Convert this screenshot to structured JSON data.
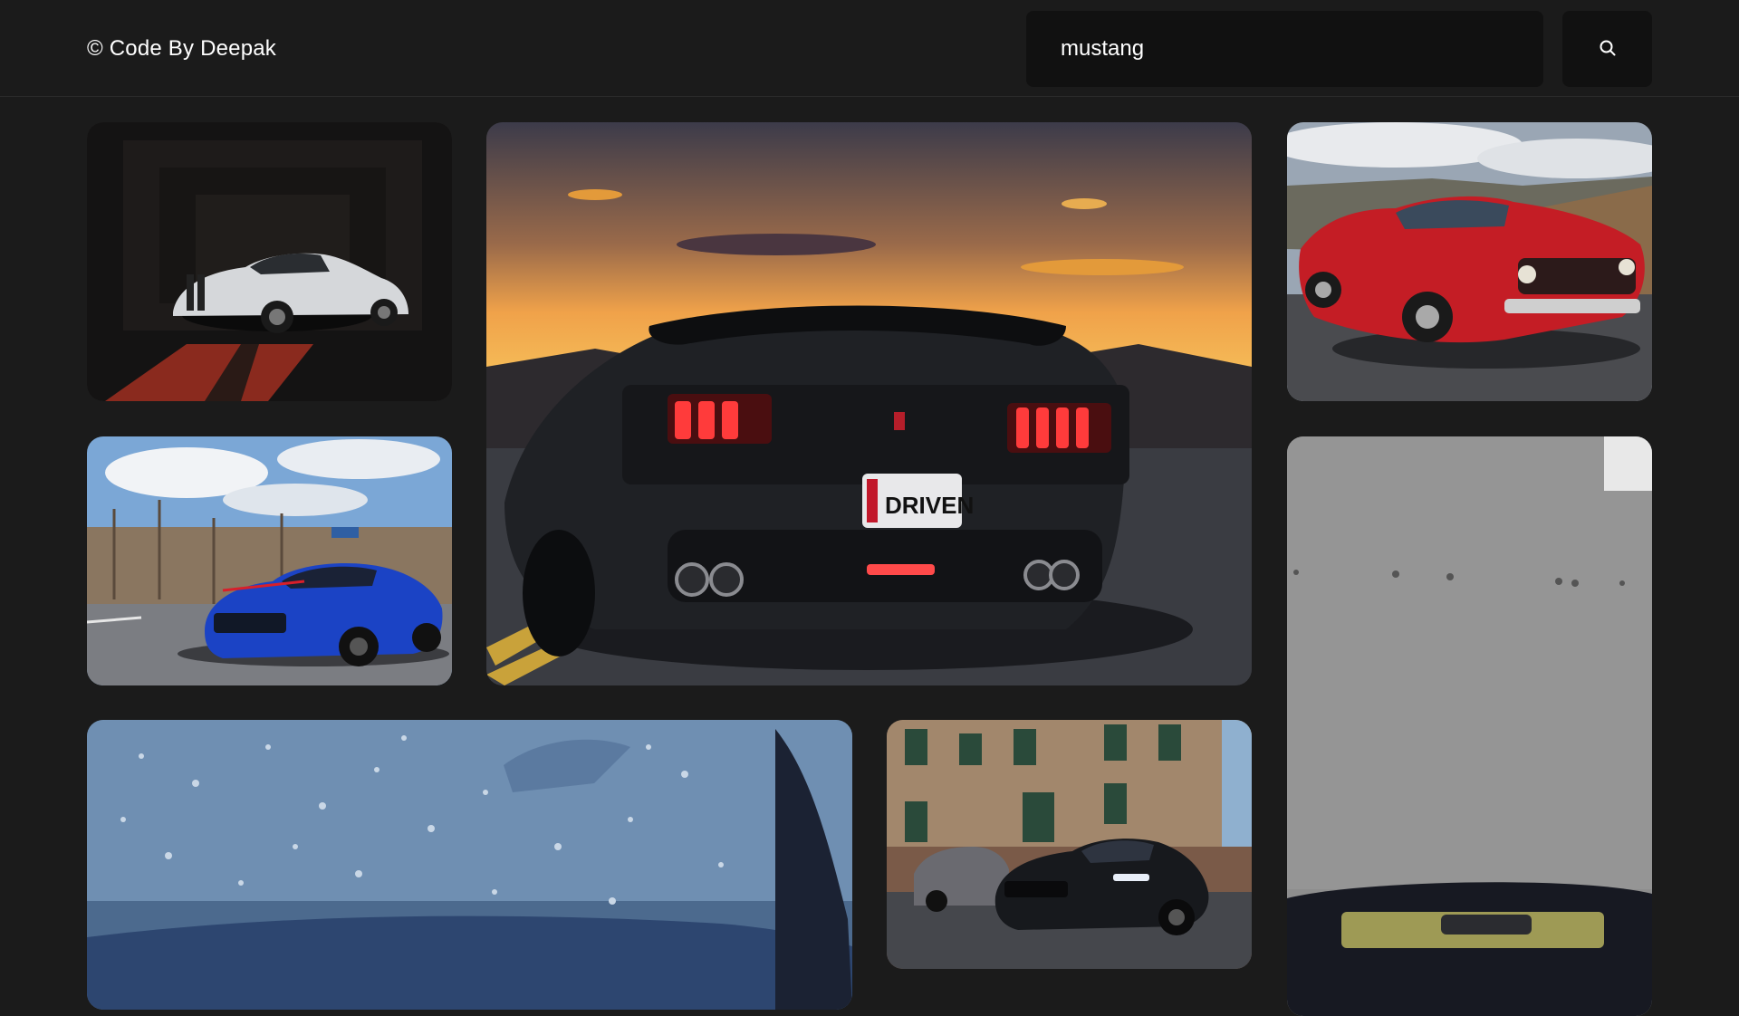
{
  "header": {
    "brand": "© Code By Deepak"
  },
  "search": {
    "value": "mustang",
    "icon": "search-icon"
  },
  "colors": {
    "background": "#1b1b1b",
    "search_background": "#111111",
    "text": "#ffffff"
  },
  "gallery": {
    "photos": [
      {
        "subject": "white-mustang-in-dark-tunnel"
      },
      {
        "subject": "black-shelby-rear-at-sunset"
      },
      {
        "subject": "red-classic-mustang-mach1"
      },
      {
        "subject": "blue-shelby-on-road"
      },
      {
        "subject": "grey-wall-with-car-roof"
      },
      {
        "subject": "wet-blue-hood-with-raindrops"
      },
      {
        "subject": "black-mustang-by-old-building"
      }
    ],
    "plate_text": "DRIVEN"
  }
}
